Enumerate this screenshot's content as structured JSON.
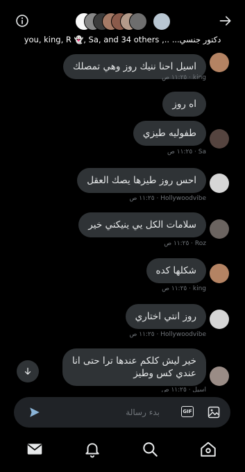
{
  "header": {
    "group_name": "دكتور جنسي...",
    "members_prefix": ".., you, king, R",
    "members_ghost": "👻",
    "members_suffix": ", Sa, and 34 others",
    "info_icon": "info-icon",
    "back_icon": "arrow-right-icon"
  },
  "messages": [
    {
      "text": "اسيل احنا ننيك روز وهي تمصلك",
      "sender": "king",
      "time": "١١:٢٥ ص"
    },
    {
      "text": "اه روز",
      "sender": "",
      "time": ""
    },
    {
      "text": "طفوليه طيزي",
      "sender": "Sa",
      "time": "١١:٢٥ ص"
    },
    {
      "text": "احس روز طيزها يصك العقل",
      "sender": "Hollywoodvibe",
      "time": "١١:٢٥ ص"
    },
    {
      "text": "سلامات الكل يي ينيكني خير",
      "sender": "Roz",
      "time": "١١:٢٥ ص"
    },
    {
      "text": "شكلها كده",
      "sender": "king",
      "time": "١١:٢٥ ص"
    },
    {
      "text": "روز انتي اختاري",
      "sender": "Hollywoodvibe",
      "time": "١١:٢٥ ص"
    },
    {
      "line1": "خير ليش كلكم عندها ترا حتى انا",
      "line2": "عندي كس وطيز",
      "sender": "اسيل",
      "time": "١١:٢٥ ص"
    }
  ],
  "composer": {
    "placeholder": "بدء رسالة",
    "gif_label": "GIF",
    "send_icon": "send-icon",
    "image_icon": "image-icon"
  },
  "nav": {
    "items": [
      "mail-icon",
      "notifications-icon",
      "search-icon",
      "home-icon"
    ]
  },
  "colors": {
    "background": "#000000",
    "bubble": "#2f3336",
    "text": "#e7e9ea",
    "muted": "#71767b",
    "composer": "#202327"
  }
}
